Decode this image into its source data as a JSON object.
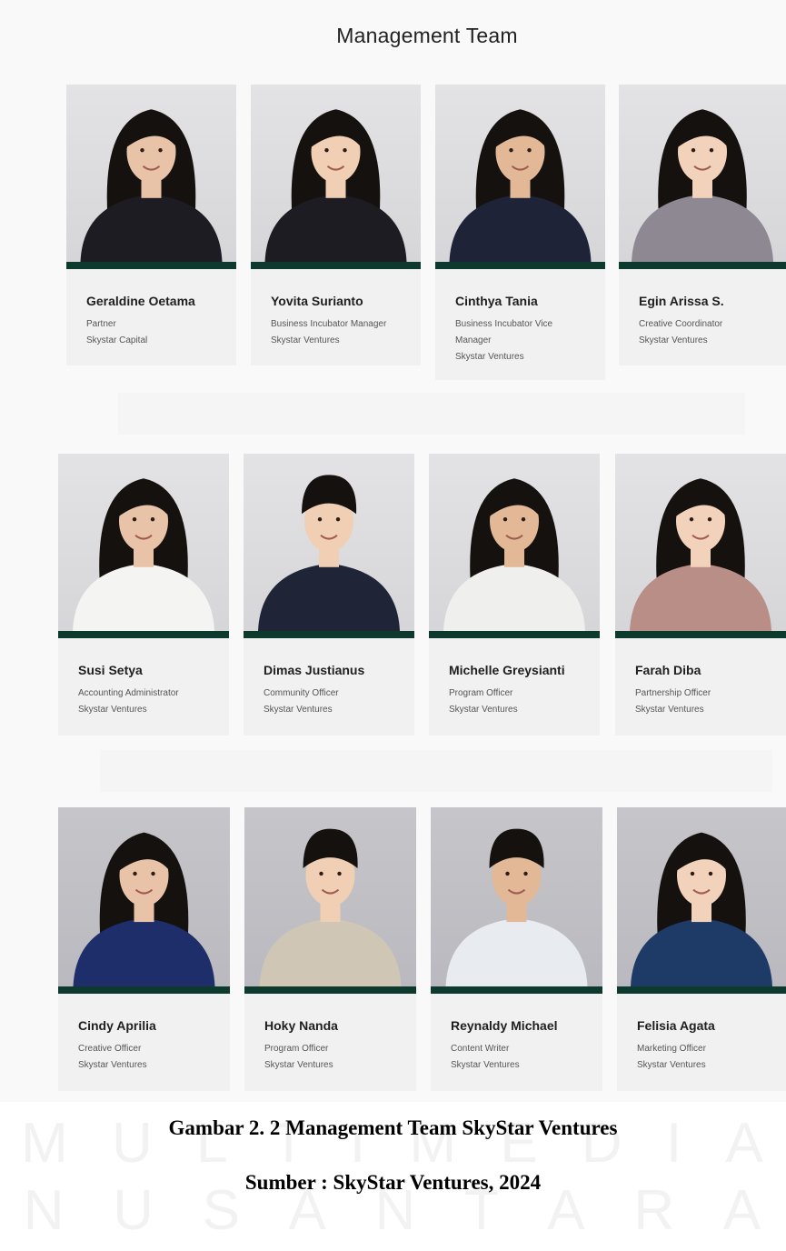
{
  "section_title": "Management Team",
  "colors": {
    "accent_bar": "#0d3a2c",
    "card_bg": "#f1f1f1"
  },
  "rows": [
    {
      "members": [
        {
          "name": "Geraldine Oetama",
          "role_lines": [
            "Partner",
            "Skystar Capital"
          ],
          "photo": "portrait-woman-black-blazer"
        },
        {
          "name": "Yovita Surianto",
          "role_lines": [
            "Business Incubator Manager",
            "Skystar Ventures"
          ],
          "photo": "portrait-woman-black-blazer"
        },
        {
          "name": "Cinthya Tania",
          "role_lines": [
            "Business Incubator Vice",
            "Manager",
            "Skystar Ventures"
          ],
          "photo": "portrait-woman-navy-top"
        },
        {
          "name": "Egin Arissa S.",
          "role_lines": [
            "Creative Coordinator",
            "Skystar Ventures"
          ],
          "photo": "portrait-woman-grey-blouse"
        }
      ]
    },
    {
      "members": [
        {
          "name": "Susi Setya",
          "role_lines": [
            "Accounting Administrator",
            "Skystar Ventures"
          ],
          "photo": "portrait-woman-white-blouse"
        },
        {
          "name": "Dimas Justianus",
          "role_lines": [
            "Community Officer",
            "Skystar Ventures"
          ],
          "photo": "portrait-man-navy-sweater"
        },
        {
          "name": "Michelle Greysianti",
          "role_lines": [
            "Program Officer",
            "Skystar Ventures"
          ],
          "photo": "portrait-woman-white-shirt"
        },
        {
          "name": "Farah Diba",
          "role_lines": [
            "Partnership Officer",
            "Skystar Ventures"
          ],
          "photo": "portrait-woman-pink-blazer"
        }
      ]
    },
    {
      "members": [
        {
          "name": "Cindy Aprilia",
          "role_lines": [
            "Creative Officer",
            "Skystar Ventures"
          ],
          "photo": "portrait-woman-blue-blouse"
        },
        {
          "name": "Hoky Nanda",
          "role_lines": [
            "Program Officer",
            "Skystar Ventures"
          ],
          "photo": "portrait-man-patterned-shirt"
        },
        {
          "name": "Reynaldy Michael",
          "role_lines": [
            "Content Writer",
            "Skystar Ventures"
          ],
          "photo": "portrait-man-white-shirt"
        },
        {
          "name": "Felisia Agata",
          "role_lines": [
            "Marketing Officer",
            "Skystar Ventures"
          ],
          "photo": "portrait-woman-navy-blazer"
        }
      ]
    }
  ],
  "caption": "Gambar 2. 2 Management Team SkyStar Ventures",
  "source": "Sumber : SkyStar Ventures, 2024",
  "watermark_lines": [
    "MULTIMEDIA",
    "NUSANTARA"
  ]
}
